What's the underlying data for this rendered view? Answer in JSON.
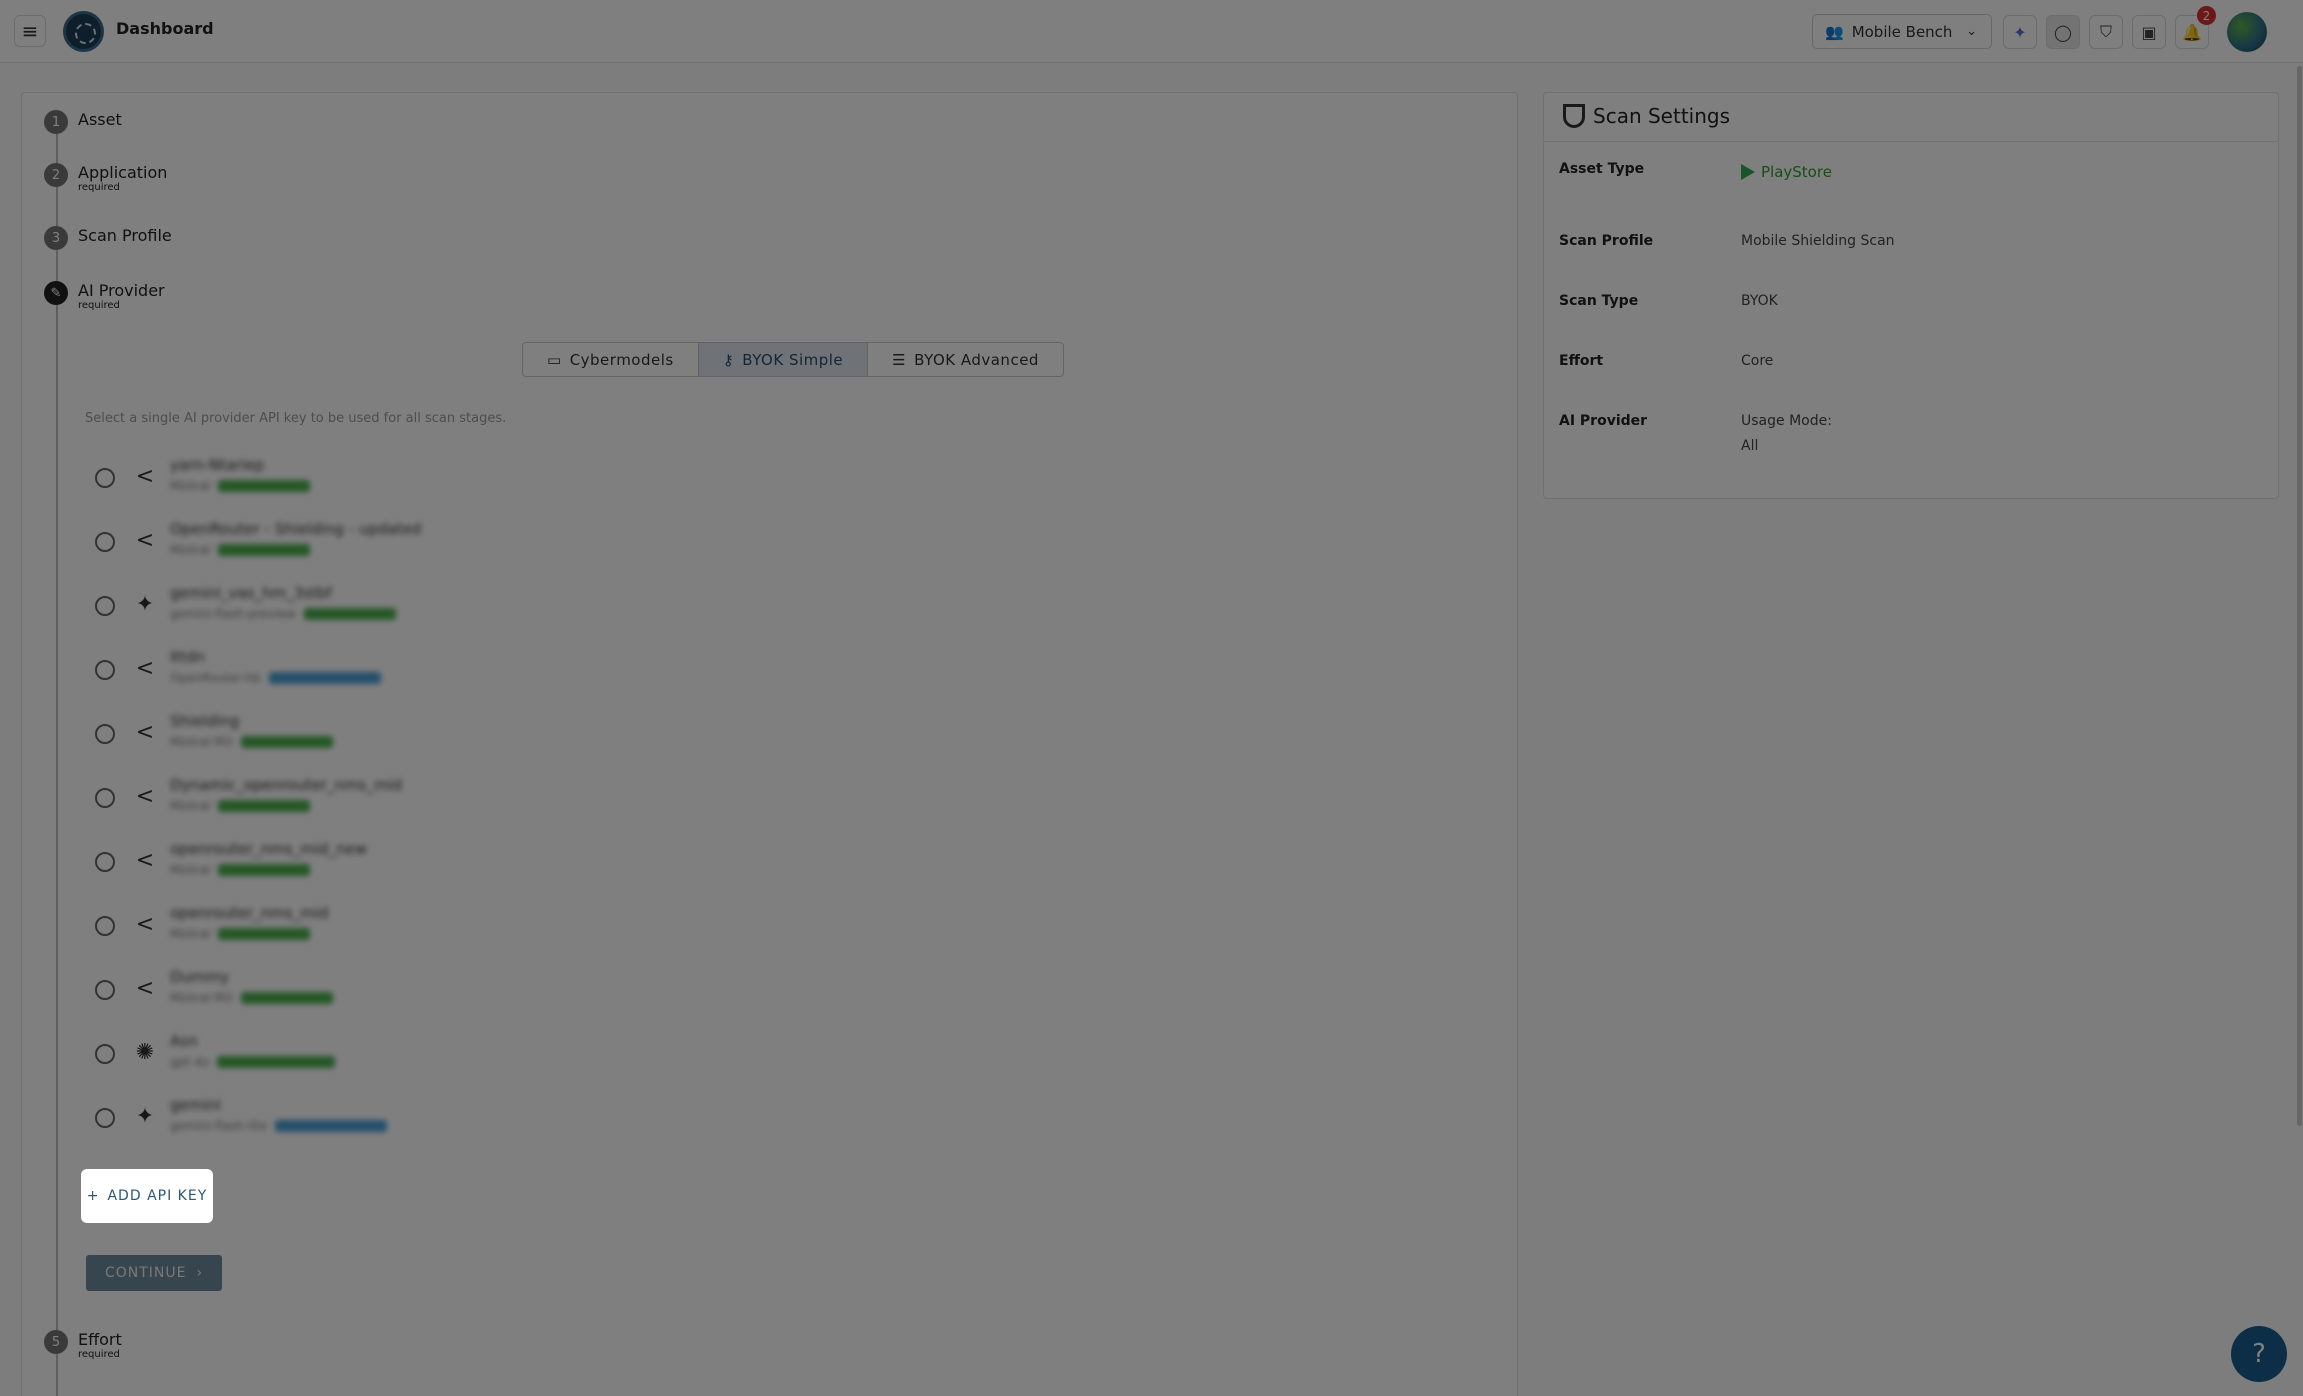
{
  "appbar": {
    "title": "Dashboard",
    "team": "Mobile Bench",
    "notification_count": "2",
    "icons": [
      "menu-icon",
      "ai-sparkle-icon",
      "chat-icon",
      "shield-icon",
      "badge-icon",
      "bell-icon"
    ]
  },
  "steps": [
    {
      "num": "1",
      "label": "Asset",
      "sub": ""
    },
    {
      "num": "2",
      "label": "Application",
      "sub": "required"
    },
    {
      "num": "3",
      "label": "Scan Profile",
      "sub": ""
    },
    {
      "num": "4",
      "label": "AI Provider",
      "sub": "required"
    },
    {
      "num": "5",
      "label": "Effort",
      "sub": "required"
    }
  ],
  "provider_tabs": [
    {
      "label": "Cybermodels",
      "icon": "card-icon"
    },
    {
      "label": "BYOK Simple",
      "icon": "key-icon",
      "selected": true
    },
    {
      "label": "BYOK Advanced",
      "icon": "sliders-icon"
    }
  ],
  "hint": "Select a single AI provider API key to be used for all scan stages.",
  "api_keys": [
    {
      "name": "yarn-Ntariep",
      "meta": "Mistral",
      "icon": "share-icon"
    },
    {
      "name": "OpenRouter - Shielding - updated",
      "meta": "Mistral",
      "icon": "share-icon"
    },
    {
      "name": "gemini_vas_hm_3stbf",
      "meta": "gemini-flash-preview",
      "icon": "sparkle-icon"
    },
    {
      "name": "Ittdn",
      "meta": "OpenRouter-hb",
      "icon": "share-icon"
    },
    {
      "name": "Shielding",
      "meta": "Mistral-M3",
      "icon": "share-icon"
    },
    {
      "name": "Dynamic_openrouter_nms_mid",
      "meta": "Mistral",
      "icon": "share-icon"
    },
    {
      "name": "openrouter_nms_mid_new",
      "meta": "Mistral",
      "icon": "share-icon"
    },
    {
      "name": "openrouter_nms_mid",
      "meta": "Mistral",
      "icon": "share-icon"
    },
    {
      "name": "Dummy",
      "meta": "Mistral-M3",
      "icon": "share-icon"
    },
    {
      "name": "Asn",
      "meta": "gpt-4o",
      "icon": "openai-icon"
    },
    {
      "name": "gemini",
      "meta": "gemini-flash-lite",
      "icon": "sparkle-icon"
    }
  ],
  "actions": {
    "add_api_key": "ADD API KEY",
    "continue": "CONTINUE"
  },
  "scan_settings": {
    "title": "Scan Settings",
    "rows": [
      {
        "label": "Asset Type",
        "value": "PlayStore"
      },
      {
        "label": "Scan Profile",
        "value": "Mobile Shielding Scan"
      },
      {
        "label": "Scan Type",
        "value": "BYOK"
      },
      {
        "label": "Effort",
        "value": "Core"
      },
      {
        "label": "AI Provider",
        "value": "Usage Mode:",
        "value2": "All"
      }
    ]
  },
  "help_label": "?"
}
